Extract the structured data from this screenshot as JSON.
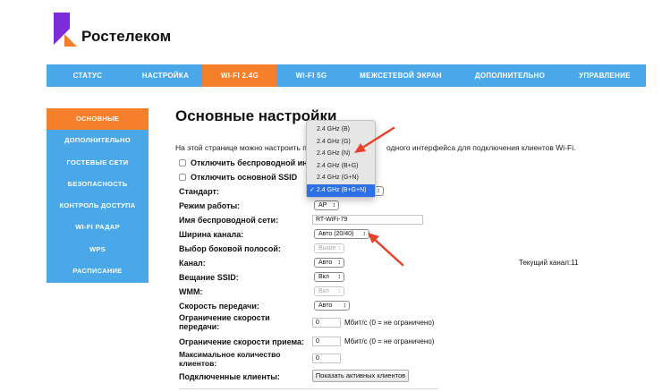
{
  "brand": {
    "name": "Ростелеком",
    "colors": {
      "purple": "#7b2bd8",
      "orange": "#f57f2a",
      "blue": "#4aa8e8",
      "selected": "#2d6fe5"
    }
  },
  "topnav": [
    {
      "label": "СТАТУС"
    },
    {
      "label": "НАСТРОЙКА"
    },
    {
      "label": "WI-FI 2.4G",
      "active": true
    },
    {
      "label": "WI-FI 5G"
    },
    {
      "label": "МЕЖСЕТЕВОЙ ЭКРАН"
    },
    {
      "label": "ДОПОЛНИТЕЛЬНО"
    },
    {
      "label": "УПРАВЛЕНИЕ"
    }
  ],
  "sidebar": [
    {
      "label": "ОСНОВНЫЕ",
      "active": true
    },
    {
      "label": "ДОПОЛНИТЕЛЬНО"
    },
    {
      "label": "ГОСТЕВЫЕ СЕТИ"
    },
    {
      "label": "БЕЗОПАСНОСТЬ"
    },
    {
      "label": "КОНТРОЛЬ ДОСТУПА"
    },
    {
      "label": "WI-FI РАДАР"
    },
    {
      "label": "WPS"
    },
    {
      "label": "РАСПИСАНИЕ"
    }
  ],
  "main": {
    "title": "Основные настройки",
    "intro_left": "На этой странице можно настроить п",
    "intro_right": "одного интерфейса для подключения клиентов Wi-Fi.",
    "disable_wireless": "Отключить беспроводной ин",
    "disable_main_ssid": "Отключить основной SSID",
    "labels": {
      "standard": "Стандарт:",
      "mode": "Режим работы:",
      "ssid": "Имя беспроводной сети:",
      "bandwidth": "Ширина канала:",
      "sideband": "Выбор боковой полосой:",
      "channel": "Канал:",
      "broadcast": "Вещание SSID:",
      "wmm": "WMM:",
      "tx_rate": "Скорость передачи:",
      "tx_limit": "Ограничение скорости передачи:",
      "rx_limit": "Ограничение скорости приема:",
      "max_clients": "Максимальное количество клиентов:",
      "connected": "Подключенные клиенты:"
    },
    "values": {
      "mode": "AP",
      "ssid": "RT-WiFi-79",
      "bandwidth": "Авто (20/40)",
      "sideband": "Выше",
      "channel": "Авто",
      "broadcast": "Вкл",
      "wmm": "Вкл",
      "tx_rate": "Авто",
      "tx_limit": "0",
      "rx_limit": "0",
      "max_clients": "0"
    },
    "limit_note": "Мбит/с (0 = не ограничено)",
    "current_channel": "Текущий канал:11",
    "show_clients_button": "Показать активных клиентов"
  },
  "standard_dropdown": {
    "options": [
      "2.4 GHz (B)",
      "2.4 GHz (G)",
      "2.4 GHz (N)",
      "2.4 GHz (B+G)",
      "2.4 GHz (G+N)",
      "2.4 GHz (B+G+N)"
    ],
    "selected": "2.4 GHz (B+G+N)",
    "checkmark": "✓"
  },
  "annotations": {
    "arrow_color": "#e8412a"
  }
}
